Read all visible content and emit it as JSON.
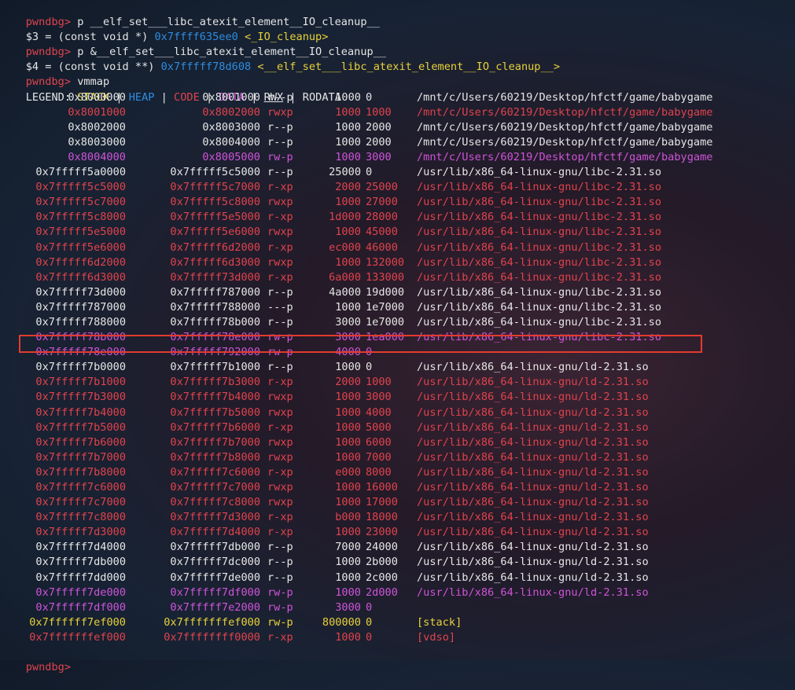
{
  "commands": [
    {
      "prompt": "pwndbg> ",
      "cmd": "p __elf_set___libc_atexit_element__IO_cleanup__"
    },
    {
      "result_pre": "$3 = (const void *) ",
      "addr": "0x7ffff635ee0",
      "sym": "<_IO_cleanup>"
    },
    {
      "prompt": "pwndbg> ",
      "cmd": "p &__elf_set___libc_atexit_element__IO_cleanup__"
    },
    {
      "result_pre": "$4 = (const void **) ",
      "addr": "0x7fffff78d608",
      "sym": "<__elf_set___libc_atexit_element__IO_cleanup__>"
    },
    {
      "prompt": "pwndbg> ",
      "cmd": "vmmap"
    }
  ],
  "legend": {
    "label": "LEGEND: ",
    "sep": " | ",
    "stack": "STACK",
    "heap": "HEAP",
    "code": "CODE",
    "data": "DATA",
    "rwx": "RWX",
    "rodata": "RODATA"
  },
  "vmmap": [
    {
      "start": "0x8000000",
      "end": "0x8001000",
      "perm": "r--p",
      "size": "1000",
      "offset": "0",
      "objfile": "/mnt/c/Users/60219/Desktop/hfctf/game/babygame",
      "kind": "default"
    },
    {
      "start": "0x8001000",
      "end": "0x8002000",
      "perm": "rwxp",
      "size": "1000",
      "offset": "1000",
      "objfile": "/mnt/c/Users/60219/Desktop/hfctf/game/babygame",
      "kind": "code"
    },
    {
      "start": "0x8002000",
      "end": "0x8003000",
      "perm": "r--p",
      "size": "1000",
      "offset": "2000",
      "objfile": "/mnt/c/Users/60219/Desktop/hfctf/game/babygame",
      "kind": "default"
    },
    {
      "start": "0x8003000",
      "end": "0x8004000",
      "perm": "r--p",
      "size": "1000",
      "offset": "2000",
      "objfile": "/mnt/c/Users/60219/Desktop/hfctf/game/babygame",
      "kind": "default"
    },
    {
      "start": "0x8004000",
      "end": "0x8005000",
      "perm": "rw-p",
      "size": "1000",
      "offset": "3000",
      "objfile": "/mnt/c/Users/60219/Desktop/hfctf/game/babygame",
      "kind": "data"
    },
    {
      "start": "0x7fffff5a0000",
      "end": "0x7fffff5c5000",
      "perm": "r--p",
      "size": "25000",
      "offset": "0",
      "objfile": "/usr/lib/x86_64-linux-gnu/libc-2.31.so",
      "kind": "default"
    },
    {
      "start": "0x7fffff5c5000",
      "end": "0x7fffff5c7000",
      "perm": "r-xp",
      "size": "2000",
      "offset": "25000",
      "objfile": "/usr/lib/x86_64-linux-gnu/libc-2.31.so",
      "kind": "code"
    },
    {
      "start": "0x7fffff5c7000",
      "end": "0x7fffff5c8000",
      "perm": "rwxp",
      "size": "1000",
      "offset": "27000",
      "objfile": "/usr/lib/x86_64-linux-gnu/libc-2.31.so",
      "kind": "code"
    },
    {
      "start": "0x7fffff5c8000",
      "end": "0x7fffff5e5000",
      "perm": "r-xp",
      "size": "1d000",
      "offset": "28000",
      "objfile": "/usr/lib/x86_64-linux-gnu/libc-2.31.so",
      "kind": "code"
    },
    {
      "start": "0x7fffff5e5000",
      "end": "0x7fffff5e6000",
      "perm": "rwxp",
      "size": "1000",
      "offset": "45000",
      "objfile": "/usr/lib/x86_64-linux-gnu/libc-2.31.so",
      "kind": "code"
    },
    {
      "start": "0x7fffff5e6000",
      "end": "0x7fffff6d2000",
      "perm": "r-xp",
      "size": "ec000",
      "offset": "46000",
      "objfile": "/usr/lib/x86_64-linux-gnu/libc-2.31.so",
      "kind": "code"
    },
    {
      "start": "0x7fffff6d2000",
      "end": "0x7fffff6d3000",
      "perm": "rwxp",
      "size": "1000",
      "offset": "132000",
      "objfile": "/usr/lib/x86_64-linux-gnu/libc-2.31.so",
      "kind": "code"
    },
    {
      "start": "0x7fffff6d3000",
      "end": "0x7fffff73d000",
      "perm": "r-xp",
      "size": "6a000",
      "offset": "133000",
      "objfile": "/usr/lib/x86_64-linux-gnu/libc-2.31.so",
      "kind": "code"
    },
    {
      "start": "0x7fffff73d000",
      "end": "0x7fffff787000",
      "perm": "r--p",
      "size": "4a000",
      "offset": "19d000",
      "objfile": "/usr/lib/x86_64-linux-gnu/libc-2.31.so",
      "kind": "default"
    },
    {
      "start": "0x7fffff787000",
      "end": "0x7fffff788000",
      "perm": "---p",
      "size": "1000",
      "offset": "1e7000",
      "objfile": "/usr/lib/x86_64-linux-gnu/libc-2.31.so",
      "kind": "default"
    },
    {
      "start": "0x7fffff788000",
      "end": "0x7fffff78b000",
      "perm": "r--p",
      "size": "3000",
      "offset": "1e7000",
      "objfile": "/usr/lib/x86_64-linux-gnu/libc-2.31.so",
      "kind": "default"
    },
    {
      "start": "0x7fffff78b000",
      "end": "0x7fffff78e000",
      "perm": "rw-p",
      "size": "3000",
      "offset": "1ea000",
      "objfile": "/usr/lib/x86_64-linux-gnu/libc-2.31.so",
      "kind": "data",
      "highlight": true
    },
    {
      "start": "0x7fffff78e000",
      "end": "0x7fffff792000",
      "perm": "rw-p",
      "size": "4000",
      "offset": "0",
      "objfile": "",
      "kind": "data"
    },
    {
      "start": "0x7fffff7b0000",
      "end": "0x7fffff7b1000",
      "perm": "r--p",
      "size": "1000",
      "offset": "0",
      "objfile": "/usr/lib/x86_64-linux-gnu/ld-2.31.so",
      "kind": "default"
    },
    {
      "start": "0x7fffff7b1000",
      "end": "0x7fffff7b3000",
      "perm": "r-xp",
      "size": "2000",
      "offset": "1000",
      "objfile": "/usr/lib/x86_64-linux-gnu/ld-2.31.so",
      "kind": "code"
    },
    {
      "start": "0x7fffff7b3000",
      "end": "0x7fffff7b4000",
      "perm": "rwxp",
      "size": "1000",
      "offset": "3000",
      "objfile": "/usr/lib/x86_64-linux-gnu/ld-2.31.so",
      "kind": "code"
    },
    {
      "start": "0x7fffff7b4000",
      "end": "0x7fffff7b5000",
      "perm": "rwxp",
      "size": "1000",
      "offset": "4000",
      "objfile": "/usr/lib/x86_64-linux-gnu/ld-2.31.so",
      "kind": "code"
    },
    {
      "start": "0x7fffff7b5000",
      "end": "0x7fffff7b6000",
      "perm": "r-xp",
      "size": "1000",
      "offset": "5000",
      "objfile": "/usr/lib/x86_64-linux-gnu/ld-2.31.so",
      "kind": "code"
    },
    {
      "start": "0x7fffff7b6000",
      "end": "0x7fffff7b7000",
      "perm": "rwxp",
      "size": "1000",
      "offset": "6000",
      "objfile": "/usr/lib/x86_64-linux-gnu/ld-2.31.so",
      "kind": "code"
    },
    {
      "start": "0x7fffff7b7000",
      "end": "0x7fffff7b8000",
      "perm": "rwxp",
      "size": "1000",
      "offset": "7000",
      "objfile": "/usr/lib/x86_64-linux-gnu/ld-2.31.so",
      "kind": "code"
    },
    {
      "start": "0x7fffff7b8000",
      "end": "0x7fffff7c6000",
      "perm": "r-xp",
      "size": "e000",
      "offset": "8000",
      "objfile": "/usr/lib/x86_64-linux-gnu/ld-2.31.so",
      "kind": "code"
    },
    {
      "start": "0x7fffff7c6000",
      "end": "0x7fffff7c7000",
      "perm": "rwxp",
      "size": "1000",
      "offset": "16000",
      "objfile": "/usr/lib/x86_64-linux-gnu/ld-2.31.so",
      "kind": "code"
    },
    {
      "start": "0x7fffff7c7000",
      "end": "0x7fffff7c8000",
      "perm": "rwxp",
      "size": "1000",
      "offset": "17000",
      "objfile": "/usr/lib/x86_64-linux-gnu/ld-2.31.so",
      "kind": "code"
    },
    {
      "start": "0x7fffff7c8000",
      "end": "0x7fffff7d3000",
      "perm": "r-xp",
      "size": "b000",
      "offset": "18000",
      "objfile": "/usr/lib/x86_64-linux-gnu/ld-2.31.so",
      "kind": "code"
    },
    {
      "start": "0x7fffff7d3000",
      "end": "0x7fffff7d4000",
      "perm": "r-xp",
      "size": "1000",
      "offset": "23000",
      "objfile": "/usr/lib/x86_64-linux-gnu/ld-2.31.so",
      "kind": "code"
    },
    {
      "start": "0x7fffff7d4000",
      "end": "0x7fffff7db000",
      "perm": "r--p",
      "size": "7000",
      "offset": "24000",
      "objfile": "/usr/lib/x86_64-linux-gnu/ld-2.31.so",
      "kind": "default"
    },
    {
      "start": "0x7fffff7db000",
      "end": "0x7fffff7dc000",
      "perm": "r--p",
      "size": "1000",
      "offset": "2b000",
      "objfile": "/usr/lib/x86_64-linux-gnu/ld-2.31.so",
      "kind": "default"
    },
    {
      "start": "0x7fffff7dd000",
      "end": "0x7fffff7de000",
      "perm": "r--p",
      "size": "1000",
      "offset": "2c000",
      "objfile": "/usr/lib/x86_64-linux-gnu/ld-2.31.so",
      "kind": "default"
    },
    {
      "start": "0x7fffff7de000",
      "end": "0x7fffff7df000",
      "perm": "rw-p",
      "size": "1000",
      "offset": "2d000",
      "objfile": "/usr/lib/x86_64-linux-gnu/ld-2.31.so",
      "kind": "data"
    },
    {
      "start": "0x7fffff7df000",
      "end": "0x7fffff7e2000",
      "perm": "rw-p",
      "size": "3000",
      "offset": "0",
      "objfile": "",
      "kind": "data"
    },
    {
      "start": "0x7ffffff7ef000",
      "end": "0x7fffffffef000",
      "perm": "rw-p",
      "size": "800000",
      "offset": "0",
      "objfile": "[stack]",
      "kind": "stack"
    },
    {
      "start": "0x7fffffffef000",
      "end": "0x7ffffffff0000",
      "perm": "r-xp",
      "size": "1000",
      "offset": "0",
      "objfile": "[vdso]",
      "kind": "code_plain"
    }
  ],
  "final_prompt": "pwndbg> ",
  "colors": {
    "prompt": "#e0434d",
    "code": "#e0434d",
    "data": "#cf54d9",
    "stack": "#e8d13a",
    "heap": "#2e8ce0",
    "highlight_box": "#e23b2e"
  }
}
